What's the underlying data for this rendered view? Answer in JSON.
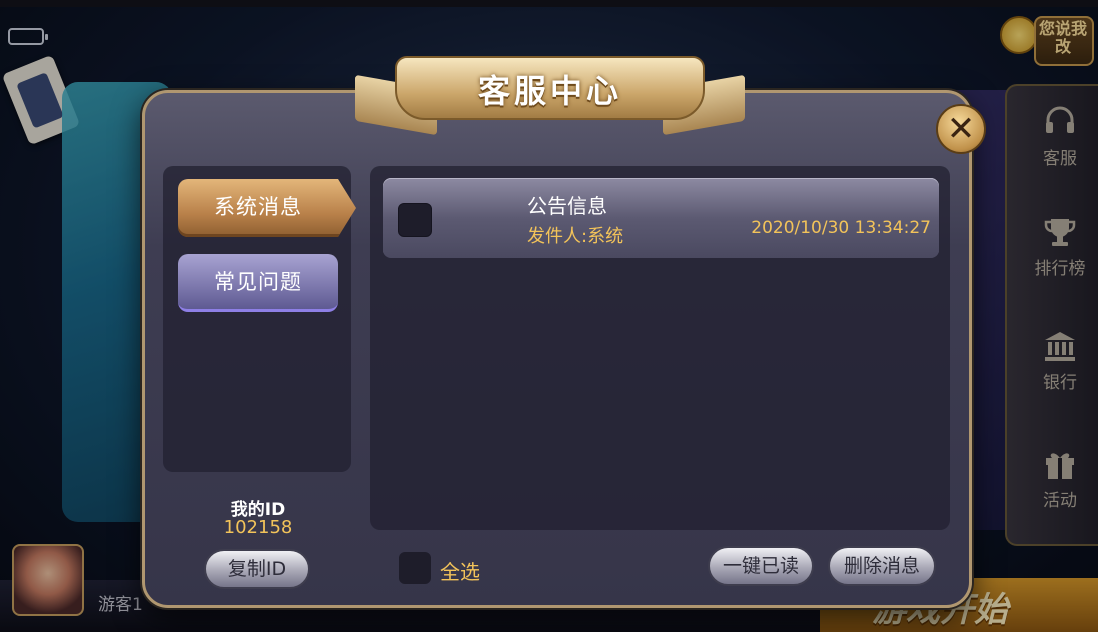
{
  "background": {
    "guest_label": "游客1",
    "start_label": "游戏开始",
    "feedback_badge": "您说我改"
  },
  "sidebar": {
    "items": [
      {
        "icon": "headset-icon",
        "label": "客服"
      },
      {
        "icon": "trophy-icon",
        "label": "排行榜"
      },
      {
        "icon": "bank-icon",
        "label": "银行"
      },
      {
        "icon": "gift-icon",
        "label": "活动"
      }
    ]
  },
  "dialog": {
    "title": "客服中心",
    "close_symbol": "✕",
    "tabs": [
      {
        "label": "系统消息",
        "active": true
      },
      {
        "label": "常见问题",
        "active": false
      }
    ],
    "my_id_label": "我的ID",
    "my_id_value": "102158",
    "copy_id_label": "复制ID",
    "messages": [
      {
        "title": "公告信息",
        "sender": "发件人:系统",
        "time": "2020/10/30 13:34:27",
        "checked": false
      }
    ],
    "select_all_label": "全选",
    "mark_read_label": "一键已读",
    "delete_label": "删除消息"
  },
  "colors": {
    "accent_gold": "#f2c35a",
    "tab_active": "#c08a50",
    "tab_inactive": "#8a85bd",
    "panel": "#3e3d52"
  }
}
